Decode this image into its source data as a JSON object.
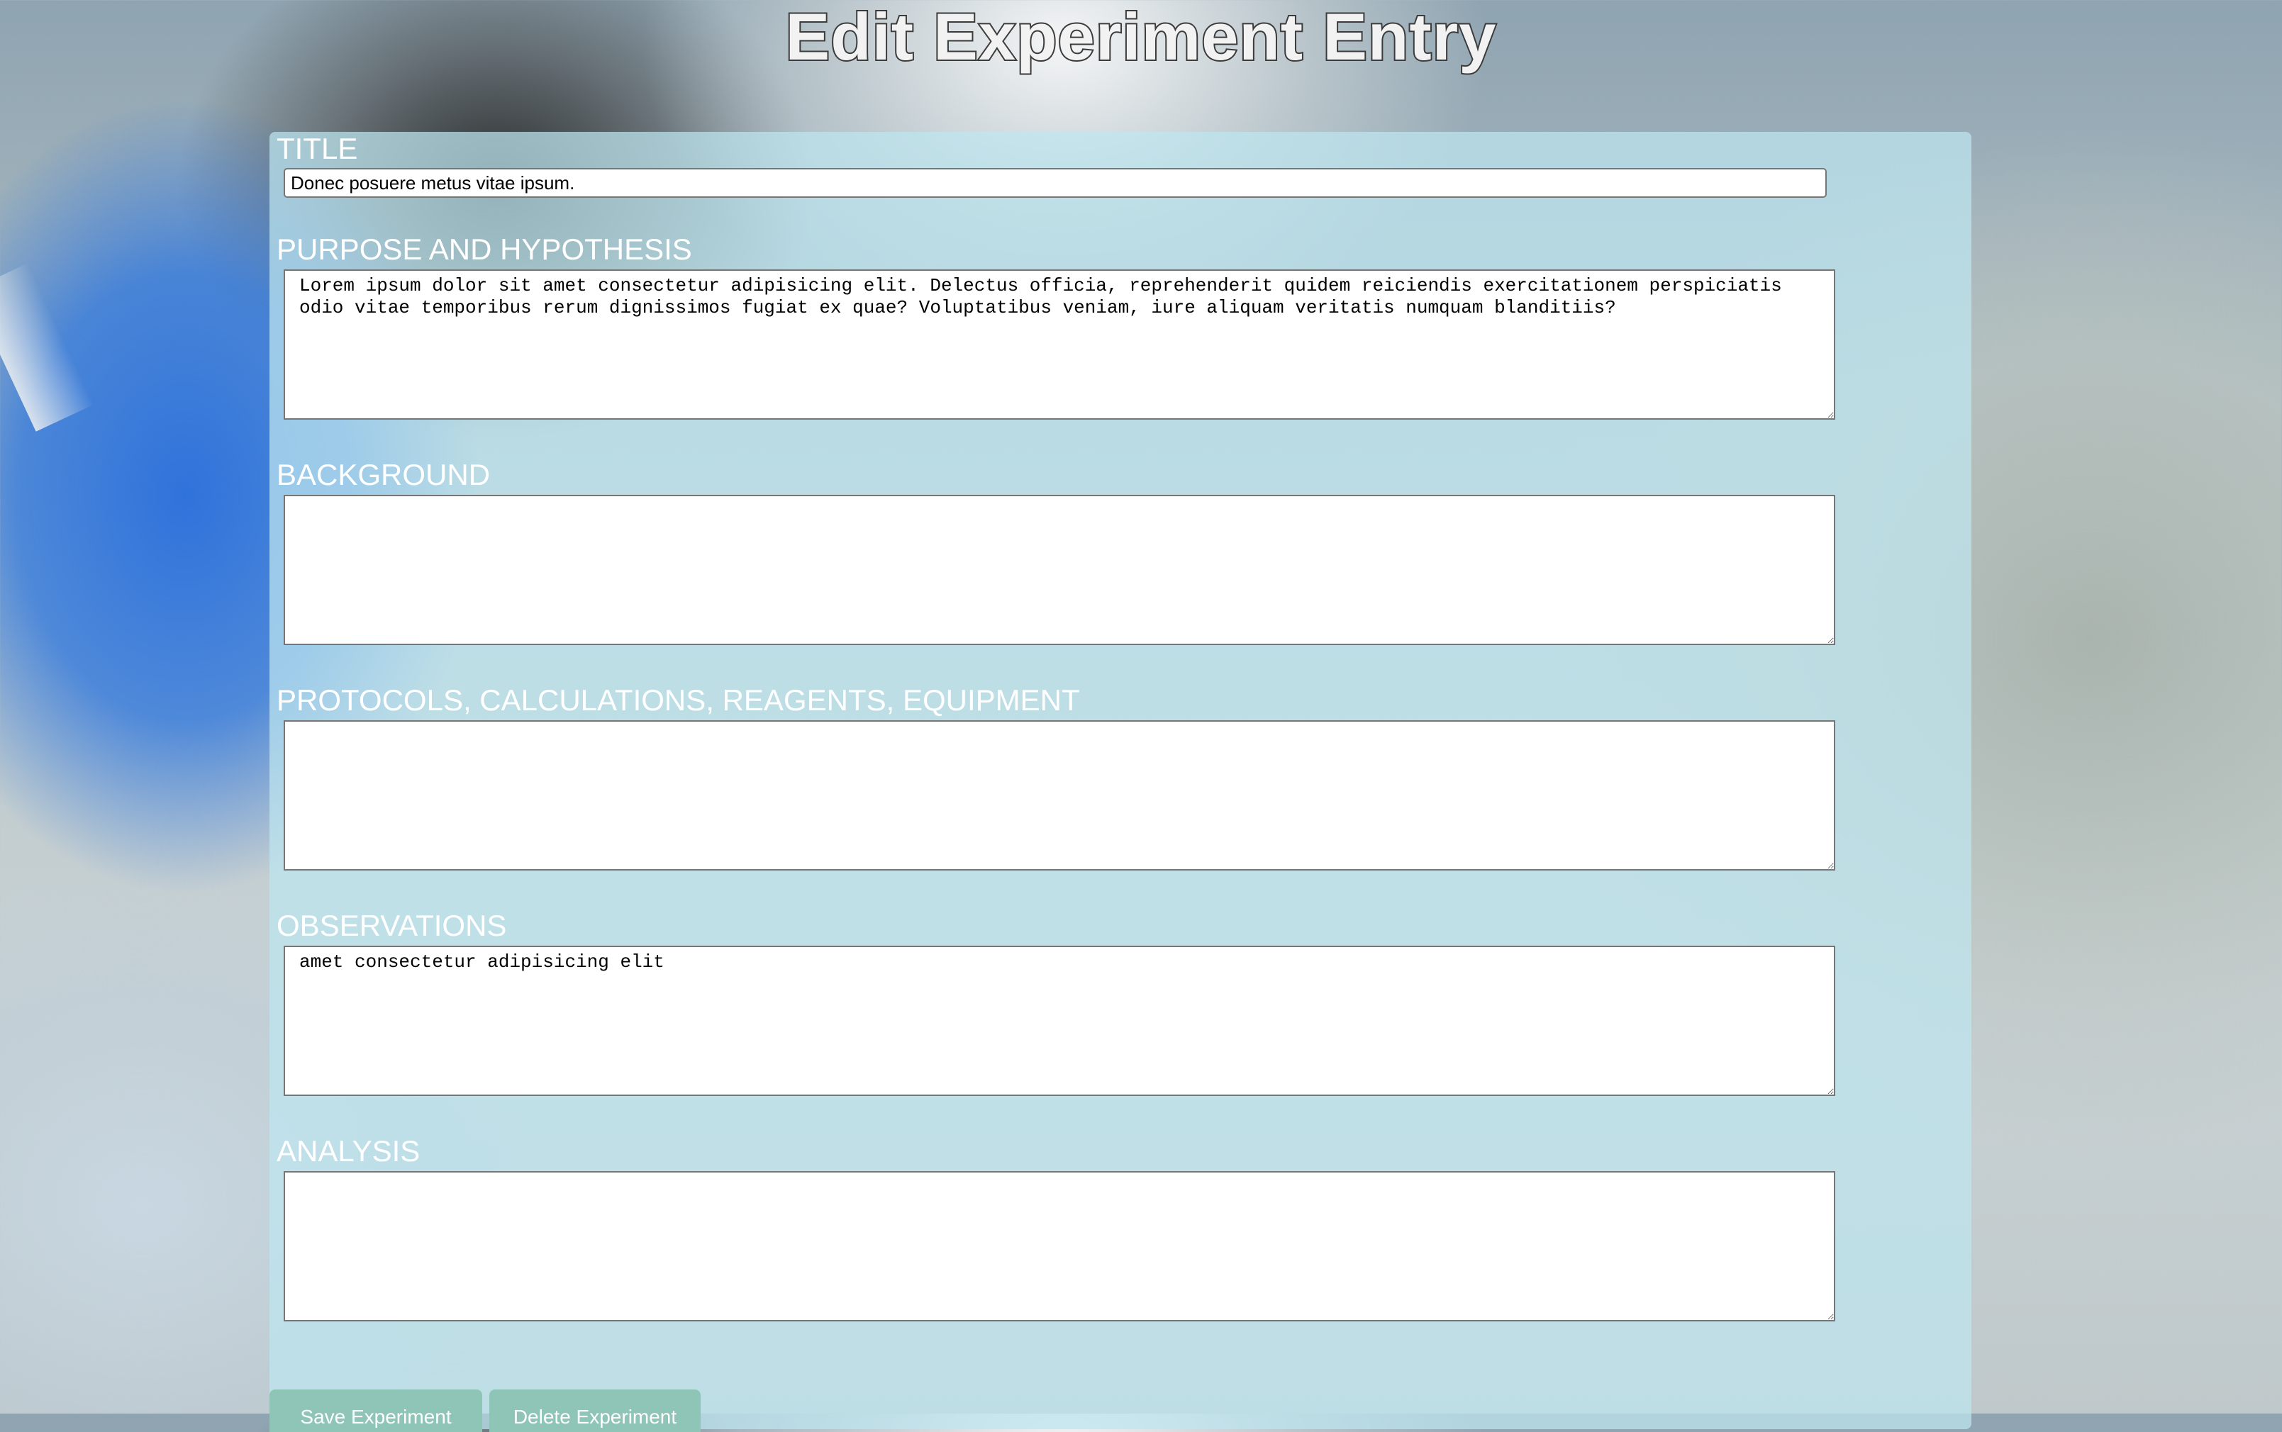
{
  "page": {
    "title": "Edit Experiment Entry"
  },
  "fields": {
    "title": {
      "label": "TITLE",
      "value": "Donec posuere metus vitae ipsum."
    },
    "purpose": {
      "label": "PURPOSE AND HYPOTHESIS",
      "value": "Lorem ipsum dolor sit amet consectetur adipisicing elit. Delectus officia, reprehenderit quidem reiciendis exercitationem perspiciatis odio vitae temporibus rerum dignissimos fugiat ex quae? Voluptatibus veniam, iure aliquam veritatis numquam blanditiis?"
    },
    "background": {
      "label": "BACKGROUND",
      "value": ""
    },
    "protocols": {
      "label": "PROTOCOLS, CALCULATIONS, REAGENTS, EQUIPMENT",
      "value": ""
    },
    "observations": {
      "label": "OBSERVATIONS",
      "value": "amet consectetur adipisicing elit"
    },
    "analysis": {
      "label": "ANALYSIS",
      "value": ""
    }
  },
  "actions": {
    "save_label": "Save Experiment",
    "delete_label": "Delete Experiment"
  },
  "colors": {
    "panel": "#bee6f0",
    "button": "#8fc5b6",
    "label": "#ffffff"
  }
}
